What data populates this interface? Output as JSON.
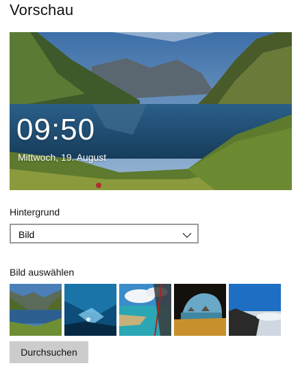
{
  "header": {
    "title": "Vorschau"
  },
  "preview": {
    "time": "09:50",
    "date": "Mittwoch, 19. August"
  },
  "background": {
    "label": "Hintergrund",
    "selected": "Bild"
  },
  "picker": {
    "label": "Bild auswählen",
    "browse_label": "Durchsuchen"
  },
  "thumbnails": [
    {
      "icon": "lake-mountain-image"
    },
    {
      "icon": "ice-cave-image"
    },
    {
      "icon": "beach-aerial-image"
    },
    {
      "icon": "sea-cave-image"
    },
    {
      "icon": "mountain-sunrise-image"
    }
  ]
}
